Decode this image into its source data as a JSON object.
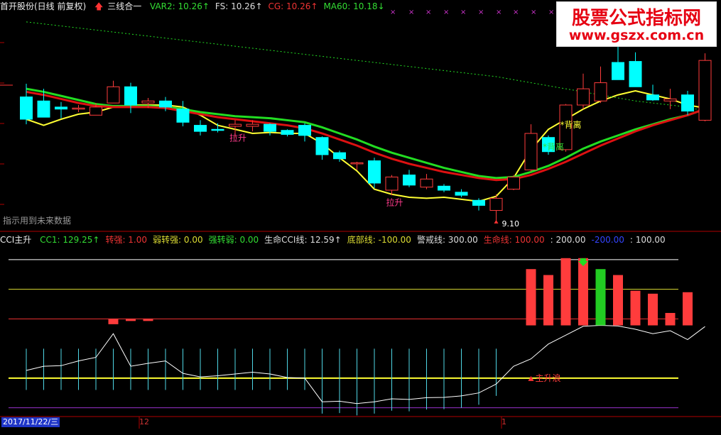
{
  "header": {
    "title": "首开股份(日线 前复权)",
    "indicator_name": "三线合一",
    "items": [
      {
        "label": "VAR2: 10.26",
        "color": "#33dd33",
        "arrow": "↑"
      },
      {
        "label": "FS: 10.26",
        "color": "#dddddd",
        "arrow": "↑"
      },
      {
        "label": "CG: 10.26",
        "color": "#ee3333",
        "arrow": "↑"
      },
      {
        "label": "MA60: 10.18",
        "color": "#33dd33",
        "arrow": "↓"
      }
    ]
  },
  "watermark": {
    "line1": "股票公式指标网",
    "line2": "www.gszx.com.cn"
  },
  "note_future_data": "指示用到未来数据",
  "indicator_header": {
    "name": "CCI主升",
    "items": [
      {
        "label": "CC1: 129.25",
        "color": "#33dd33",
        "arrow": "↑"
      },
      {
        "label": "转强: 1.00",
        "color": "#ee3333",
        "arrow": ""
      },
      {
        "label": "弱转强: 0.00",
        "color": "#dddd33",
        "arrow": ""
      },
      {
        "label": "强转弱: 0.00",
        "color": "#33dd33",
        "arrow": ""
      },
      {
        "label": "生命CCI线: 12.59",
        "color": "#dddddd",
        "arrow": "↑"
      },
      {
        "label": "底部线: -100.00",
        "color": "#dddd33",
        "arrow": ""
      },
      {
        "label": "警戒线: 300.00",
        "color": "#dddddd",
        "arrow": ""
      },
      {
        "label": "生命线: 100.00",
        "color": "#ee3333",
        "arrow": ""
      },
      {
        "label": ": 200.00",
        "color": "#dddddd",
        "arrow": ""
      },
      {
        "label": "-200.00",
        "color": "#3344ff",
        "arrow": ""
      },
      {
        "label": ": 100.00",
        "color": "#dddddd",
        "arrow": ""
      }
    ]
  },
  "bottom": {
    "date": "2017/11/22/三",
    "month_tick": "12",
    "year_tick": "1"
  },
  "colors": {
    "up": "#ff3c3c",
    "down": "#00ffff",
    "bg": "#000000"
  },
  "chart_data": [
    {
      "type": "candlestick",
      "title": "首开股份(日线 前复权)",
      "annotations": [
        {
          "text": "拉升",
          "index": 12,
          "color": "#ff3b8c"
        },
        {
          "text": "拉升",
          "index": 21,
          "color": "#ff3b8c"
        },
        {
          "text": "*背离",
          "index": 31,
          "color": "#ffff33"
        },
        {
          "text": "*背离",
          "index": 30,
          "color": "#33dd33"
        },
        {
          "text": "9.10",
          "index": 27,
          "color": "#ffffff"
        }
      ],
      "candles": [
        {
          "o": 10.32,
          "h": 10.45,
          "l": 10.05,
          "c": 10.1
        },
        {
          "o": 10.28,
          "h": 10.4,
          "l": 10.12,
          "c": 10.12
        },
        {
          "o": 10.22,
          "h": 10.27,
          "l": 10.11,
          "c": 10.2
        },
        {
          "o": 10.21,
          "h": 10.24,
          "l": 10.17,
          "c": 10.21
        },
        {
          "o": 10.14,
          "h": 10.26,
          "l": 10.14,
          "c": 10.22
        },
        {
          "o": 10.26,
          "h": 10.48,
          "l": 10.26,
          "c": 10.42
        },
        {
          "o": 10.42,
          "h": 10.46,
          "l": 10.16,
          "c": 10.24
        },
        {
          "o": 10.26,
          "h": 10.31,
          "l": 10.21,
          "c": 10.28
        },
        {
          "o": 10.28,
          "h": 10.32,
          "l": 10.18,
          "c": 10.22
        },
        {
          "o": 10.2,
          "h": 10.28,
          "l": 10.03,
          "c": 10.07
        },
        {
          "o": 10.04,
          "h": 10.09,
          "l": 9.94,
          "c": 9.98
        },
        {
          "o": 10.0,
          "h": 10.06,
          "l": 9.97,
          "c": 9.99
        },
        {
          "o": 10.03,
          "h": 10.09,
          "l": 9.92,
          "c": 10.05
        },
        {
          "o": 10.03,
          "h": 10.09,
          "l": 9.98,
          "c": 10.05
        },
        {
          "o": 10.05,
          "h": 10.06,
          "l": 9.94,
          "c": 9.98
        },
        {
          "o": 9.99,
          "h": 10.0,
          "l": 9.93,
          "c": 9.95
        },
        {
          "o": 10.04,
          "h": 10.06,
          "l": 9.88,
          "c": 9.94
        },
        {
          "o": 9.92,
          "h": 9.93,
          "l": 9.7,
          "c": 9.75
        },
        {
          "o": 9.77,
          "h": 9.79,
          "l": 9.68,
          "c": 9.71
        },
        {
          "o": 9.66,
          "h": 9.68,
          "l": 9.6,
          "c": 9.67
        },
        {
          "o": 9.69,
          "h": 9.72,
          "l": 9.42,
          "c": 9.47
        },
        {
          "o": 9.4,
          "h": 9.55,
          "l": 9.35,
          "c": 9.53
        },
        {
          "o": 9.55,
          "h": 9.6,
          "l": 9.43,
          "c": 9.45
        },
        {
          "o": 9.43,
          "h": 9.56,
          "l": 9.41,
          "c": 9.51
        },
        {
          "o": 9.44,
          "h": 9.46,
          "l": 9.38,
          "c": 9.4
        },
        {
          "o": 9.38,
          "h": 9.41,
          "l": 9.33,
          "c": 9.35
        },
        {
          "o": 9.3,
          "h": 9.32,
          "l": 9.2,
          "c": 9.25
        },
        {
          "o": 9.2,
          "h": 9.36,
          "l": 9.1,
          "c": 9.32
        },
        {
          "o": 9.41,
          "h": 9.55,
          "l": 9.4,
          "c": 9.53
        },
        {
          "o": 9.6,
          "h": 10.05,
          "l": 9.58,
          "c": 9.96
        },
        {
          "o": 9.92,
          "h": 9.94,
          "l": 9.75,
          "c": 9.78
        },
        {
          "o": 9.8,
          "h": 10.25,
          "l": 9.78,
          "c": 10.24
        },
        {
          "o": 10.24,
          "h": 10.55,
          "l": 10.2,
          "c": 10.4
        },
        {
          "o": 10.28,
          "h": 10.62,
          "l": 10.26,
          "c": 10.46
        },
        {
          "o": 10.66,
          "h": 10.9,
          "l": 10.58,
          "c": 10.49
        },
        {
          "o": 10.67,
          "h": 10.76,
          "l": 10.46,
          "c": 10.42
        },
        {
          "o": 10.34,
          "h": 10.44,
          "l": 10.28,
          "c": 10.29
        },
        {
          "o": 10.28,
          "h": 10.4,
          "l": 10.2,
          "c": 10.3
        },
        {
          "o": 10.34,
          "h": 10.38,
          "l": 10.14,
          "c": 10.18
        },
        {
          "o": 10.09,
          "h": 10.75,
          "l": 10.08,
          "c": 10.68
        }
      ],
      "series": [
        {
          "name": "VAR2",
          "color": "#ffff33",
          "values": [
            10.1,
            10.04,
            10.1,
            10.15,
            10.17,
            10.22,
            10.24,
            10.24,
            10.24,
            10.22,
            10.14,
            10.04,
            10.0,
            9.96,
            9.97,
            9.96,
            9.96,
            9.86,
            9.72,
            9.59,
            9.41,
            9.36,
            9.33,
            9.32,
            9.33,
            9.31,
            9.29,
            9.34,
            9.52,
            9.8,
            10.0,
            10.1,
            10.2,
            10.28,
            10.34,
            10.38,
            10.34,
            10.3,
            10.24,
            10.21
          ]
        },
        {
          "name": "MA60",
          "color": "#22dd22",
          "values": [
            11.06,
            11.04,
            11.02,
            11.0,
            10.98,
            10.96,
            10.94,
            10.92,
            10.9,
            10.88,
            10.86,
            10.84,
            10.82,
            10.8,
            10.78,
            10.76,
            10.74,
            10.72,
            10.7,
            10.68,
            10.66,
            10.64,
            10.62,
            10.6,
            10.58,
            10.56,
            10.54,
            10.52,
            10.49,
            10.46,
            10.43,
            10.4,
            10.37,
            10.34,
            10.31,
            10.28,
            10.26,
            10.24,
            10.22,
            10.18
          ]
        },
        {
          "name": "FS",
          "color": "#22dd22",
          "values": [
            10.4,
            10.37,
            10.33,
            10.29,
            10.25,
            10.23,
            10.23,
            10.23,
            10.22,
            10.2,
            10.17,
            10.15,
            10.13,
            10.12,
            10.11,
            10.09,
            10.07,
            10.02,
            9.96,
            9.9,
            9.83,
            9.77,
            9.72,
            9.67,
            9.62,
            9.58,
            9.54,
            9.52,
            9.53,
            9.58,
            9.64,
            9.72,
            9.81,
            9.88,
            9.94,
            10.0,
            10.05,
            10.1,
            10.14,
            10.2
          ]
        },
        {
          "name": "CG",
          "color": "#dd1111",
          "values": [
            10.37,
            10.34,
            10.3,
            10.26,
            10.23,
            10.22,
            10.22,
            10.22,
            10.21,
            10.18,
            10.15,
            10.12,
            10.1,
            10.08,
            10.06,
            10.04,
            10.01,
            9.96,
            9.9,
            9.84,
            9.77,
            9.71,
            9.66,
            9.62,
            9.58,
            9.55,
            9.52,
            9.5,
            9.51,
            9.55,
            9.61,
            9.68,
            9.76,
            9.84,
            9.91,
            9.98,
            10.04,
            10.09,
            10.14,
            10.2
          ]
        }
      ]
    },
    {
      "type": "bar",
      "title": "CCI主升",
      "levels": [
        {
          "name": "警戒线",
          "value": 300,
          "color": "#ffffff"
        },
        {
          "name": "",
          "value": 200,
          "color": "#dddd33"
        },
        {
          "name": "生命线",
          "value": 100,
          "color": "#ee3333"
        },
        {
          "name": "底部线",
          "value": -100,
          "color": "#ffff33"
        },
        {
          "name": "",
          "value": -200,
          "color": "#9933cc"
        }
      ],
      "cc1": [
        -74,
        -60,
        -58,
        -42,
        -30,
        50,
        -60,
        -50,
        -42,
        -84,
        -96,
        -92,
        -86,
        -80,
        -86,
        -98,
        -100,
        -180,
        -178,
        -186,
        -180,
        -170,
        -172,
        -166,
        -165,
        -160,
        -150,
        -120,
        -60,
        -35,
        15,
        45,
        75,
        78,
        76,
        65,
        50,
        60,
        30,
        74
      ],
      "bars": [
        {
          "index": 5,
          "top": 100,
          "bottom": 82,
          "color": "#ff3c3c"
        },
        {
          "index": 6,
          "top": 100,
          "bottom": 97,
          "color": "#ff3c3c"
        },
        {
          "index": 7,
          "top": 100,
          "bottom": 96,
          "color": "#ff3c3c"
        },
        {
          "index": 29,
          "top": 268,
          "bottom": 78,
          "color": "#ff3c3c"
        },
        {
          "index": 30,
          "top": 248,
          "bottom": 78,
          "color": "#ff3c3c"
        },
        {
          "index": 31,
          "top": 305,
          "bottom": 78,
          "color": "#ff3c3c"
        },
        {
          "index": 32,
          "top": 305,
          "bottom": 78,
          "color": "#ff3c3c"
        },
        {
          "index": 33,
          "top": 268,
          "bottom": 78,
          "color": "#22cc22"
        },
        {
          "index": 34,
          "top": 248,
          "bottom": 78,
          "color": "#ff3c3c"
        },
        {
          "index": 35,
          "top": 195,
          "bottom": 78,
          "color": "#ff3c3c"
        },
        {
          "index": 36,
          "top": 185,
          "bottom": 78,
          "color": "#ff3c3c"
        },
        {
          "index": 37,
          "top": 120,
          "bottom": 78,
          "color": "#ff3c3c"
        },
        {
          "index": 38,
          "top": 190,
          "bottom": 78,
          "color": "#ff3c3c"
        }
      ],
      "annotations": [
        {
          "text": "主升浪",
          "index": 29,
          "color": "#ff3b3b"
        }
      ]
    }
  ]
}
